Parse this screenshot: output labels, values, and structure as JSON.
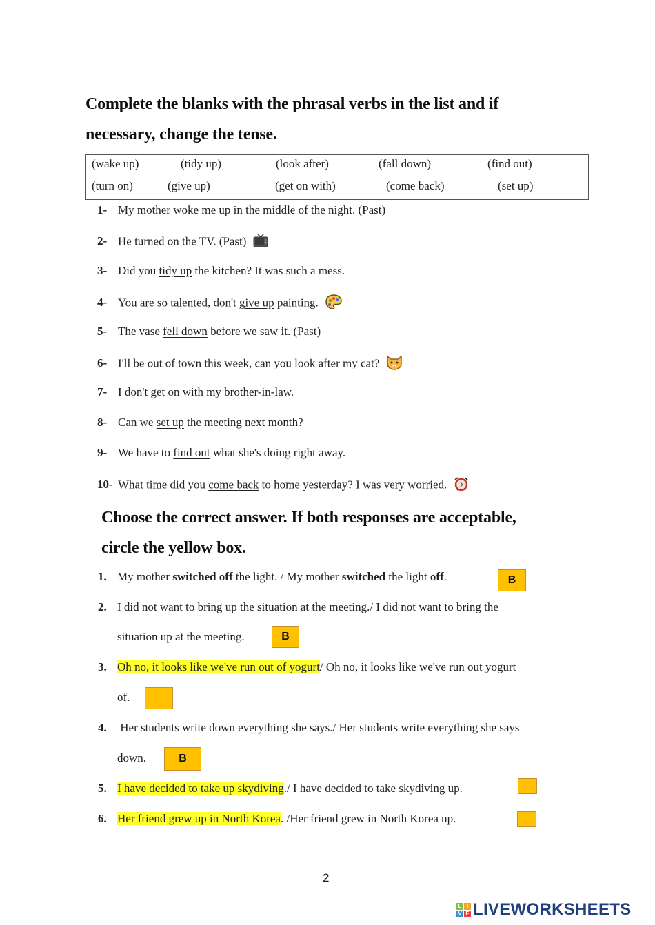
{
  "section1": {
    "title_line1": "Complete the blanks with the phrasal verbs in the list and if",
    "title_line2": "necessary, change the tense.",
    "verbs_row1": [
      "(wake up)",
      "(tidy up)",
      "(look after)",
      "(fall down)",
      "(find out)"
    ],
    "verbs_row2": [
      "(turn on)",
      "(give up)",
      "(get on with)",
      "(come back)",
      "(set up)"
    ],
    "items": [
      {
        "num": "1-",
        "parts": [
          {
            "t": "My mother "
          },
          {
            "t": "woke",
            "u": true
          },
          {
            "t": " me "
          },
          {
            "t": "up",
            "u": true
          },
          {
            "t": "  in the middle of the night. (Past)"
          }
        ]
      },
      {
        "num": "2-",
        "parts": [
          {
            "t": "He "
          },
          {
            "t": "turned on",
            "u": true
          },
          {
            "t": " the TV. (Past)"
          }
        ],
        "icon": "tv-icon"
      },
      {
        "num": "3-",
        "parts": [
          {
            "t": "Did you "
          },
          {
            "t": "tidy up",
            "u": true
          },
          {
            "t": " the kitchen? It was such a mess."
          }
        ]
      },
      {
        "num": "4-",
        "parts": [
          {
            "t": "You are so talented, don't "
          },
          {
            "t": "give up",
            "u": true
          },
          {
            "t": " painting."
          }
        ],
        "icon": "palette-icon"
      },
      {
        "num": "5-",
        "parts": [
          {
            "t": "The vase "
          },
          {
            "t": "fell down",
            "u": true
          },
          {
            "t": " before we saw it. (Past)"
          }
        ]
      },
      {
        "num": "6-",
        "parts": [
          {
            "t": "I'll be out of town this week, can you "
          },
          {
            "t": "look after",
            "u": true
          },
          {
            "t": " my cat?"
          }
        ],
        "icon": "cat-face-icon"
      },
      {
        "num": "7-",
        "parts": [
          {
            "t": "I don't "
          },
          {
            "t": "get on with",
            "u": true
          },
          {
            "t": " my brother-in-law."
          }
        ]
      },
      {
        "num": "8-",
        "parts": [
          {
            "t": "Can we "
          },
          {
            "t": "set up",
            "u": true
          },
          {
            "t": " the meeting next month?"
          }
        ]
      },
      {
        "num": "9-",
        "parts": [
          {
            "t": "We have to "
          },
          {
            "t": "find out",
            "u": true
          },
          {
            "t": " what she's doing right away."
          }
        ]
      },
      {
        "num": "10-",
        "parts": [
          {
            "t": "What time did you "
          },
          {
            "t": "come back",
            "u": true
          },
          {
            "t": " to home yesterday? I was very worried."
          }
        ],
        "icon": "alarm-clock-icon"
      }
    ]
  },
  "section2": {
    "title_line1": "Choose the correct answer. If both responses are acceptable,",
    "title_line2": "circle the yellow box.",
    "items": [
      {
        "num": "1.",
        "line1": [
          {
            "t": "My mother "
          },
          {
            "t": "switched off",
            "b": true
          },
          {
            "t": " the light. / My mother "
          },
          {
            "t": "switched",
            "b": true
          },
          {
            "t": " the light "
          },
          {
            "t": "off",
            "b": true
          },
          {
            "t": "."
          }
        ],
        "box": "B"
      },
      {
        "num": "2.",
        "line1": [
          {
            "t": "I did not want to bring up the situation at the meeting./ I did not want to bring the"
          }
        ],
        "line2": [
          {
            "t": "situation up at the meeting."
          }
        ],
        "box": "B"
      },
      {
        "num": "3.",
        "line1": [
          {
            "t": "Oh no, it looks like we've run out of yogurt",
            "hl": true
          },
          {
            "t": "/ Oh no, it looks like we've run out yogurt"
          }
        ],
        "line2": [
          {
            "t": "of."
          }
        ],
        "box": ""
      },
      {
        "num": "4.",
        "line1": [
          {
            "t": " Her students write down everything she says./ Her students write everything she says"
          }
        ],
        "line2": [
          {
            "t": "down."
          }
        ],
        "box": "B"
      },
      {
        "num": "5.",
        "line1": [
          {
            "t": "I have decided to take up skydiving",
            "hl": true
          },
          {
            "t": "./ I have decided to take skydiving up."
          }
        ],
        "box": ""
      },
      {
        "num": "6.",
        "line1": [
          {
            "t": "Her friend grew up in North Korea",
            "hl": true
          },
          {
            "t": ". /Her friend grew in North Korea up."
          }
        ],
        "box": ""
      }
    ]
  },
  "footer": {
    "page_number": "2",
    "brand": "LIVEWORKSHEETS",
    "brand_blocks": [
      "L",
      "I",
      "V",
      "E"
    ],
    "brand_color": "#1f3f7d",
    "box_color": "#ffc000",
    "highlight_color": "#ffff2e"
  }
}
